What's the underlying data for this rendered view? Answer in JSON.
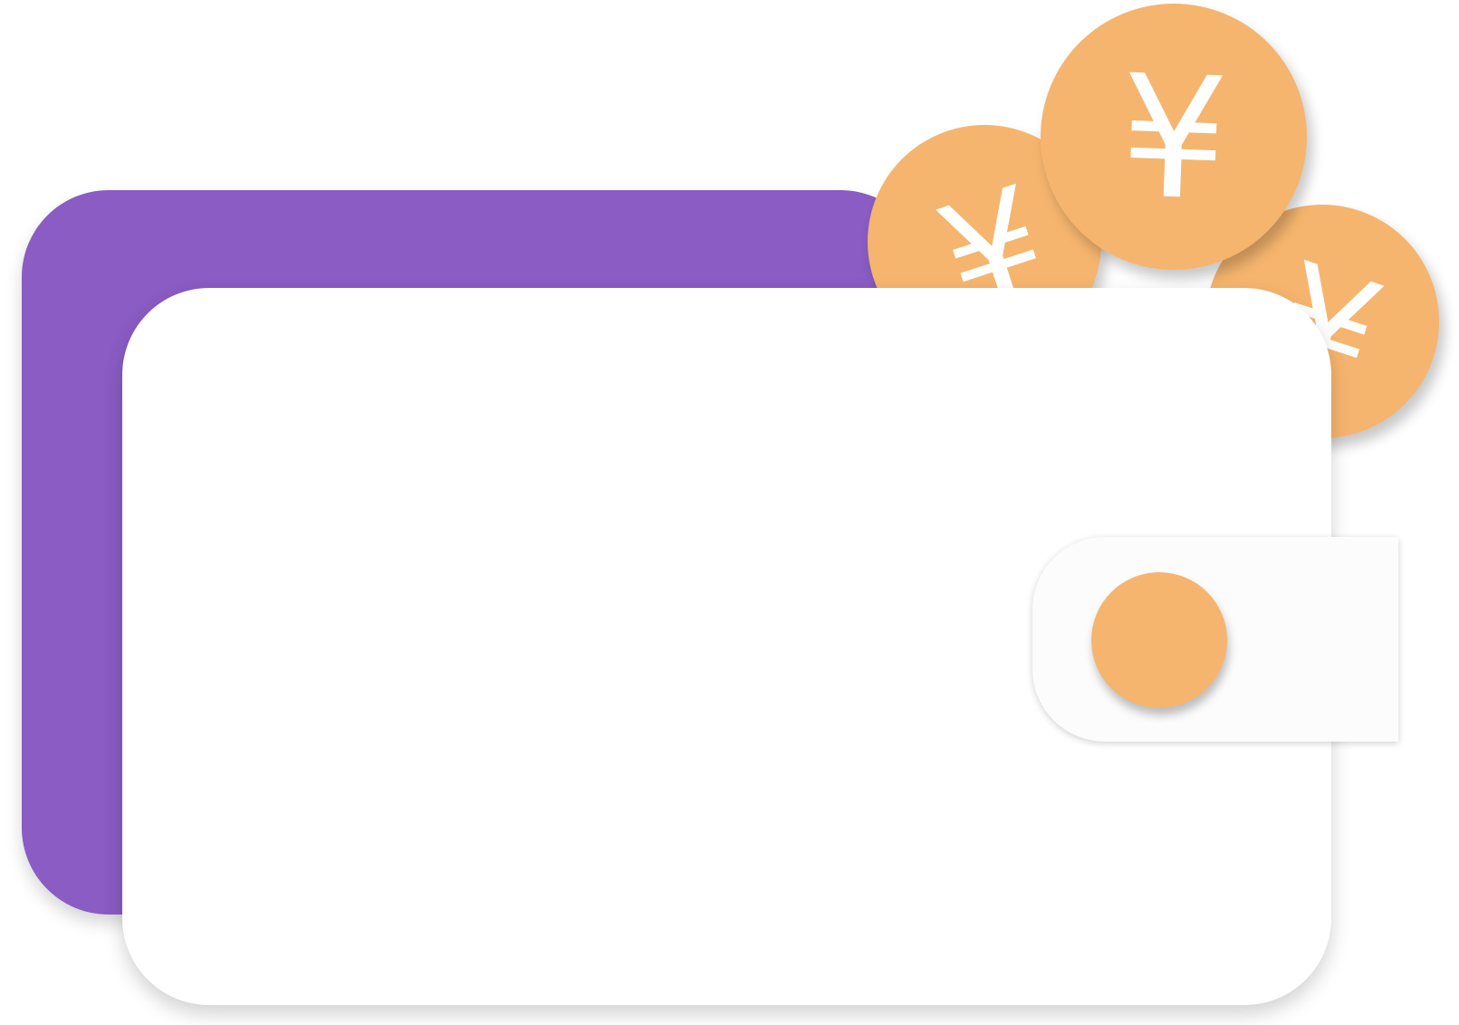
{
  "colors": {
    "wallet_back": "#8a5cc4",
    "wallet_front": "#ffffff",
    "coin": "#f5b56e",
    "clasp": "#fcfcfc",
    "clasp_button": "#f5b56e"
  },
  "coins": [
    {
      "icon": "yen-coin-icon",
      "symbol": "¥"
    },
    {
      "icon": "yen-coin-icon",
      "symbol": "¥"
    },
    {
      "icon": "yen-coin-icon",
      "symbol": "¥"
    }
  ]
}
